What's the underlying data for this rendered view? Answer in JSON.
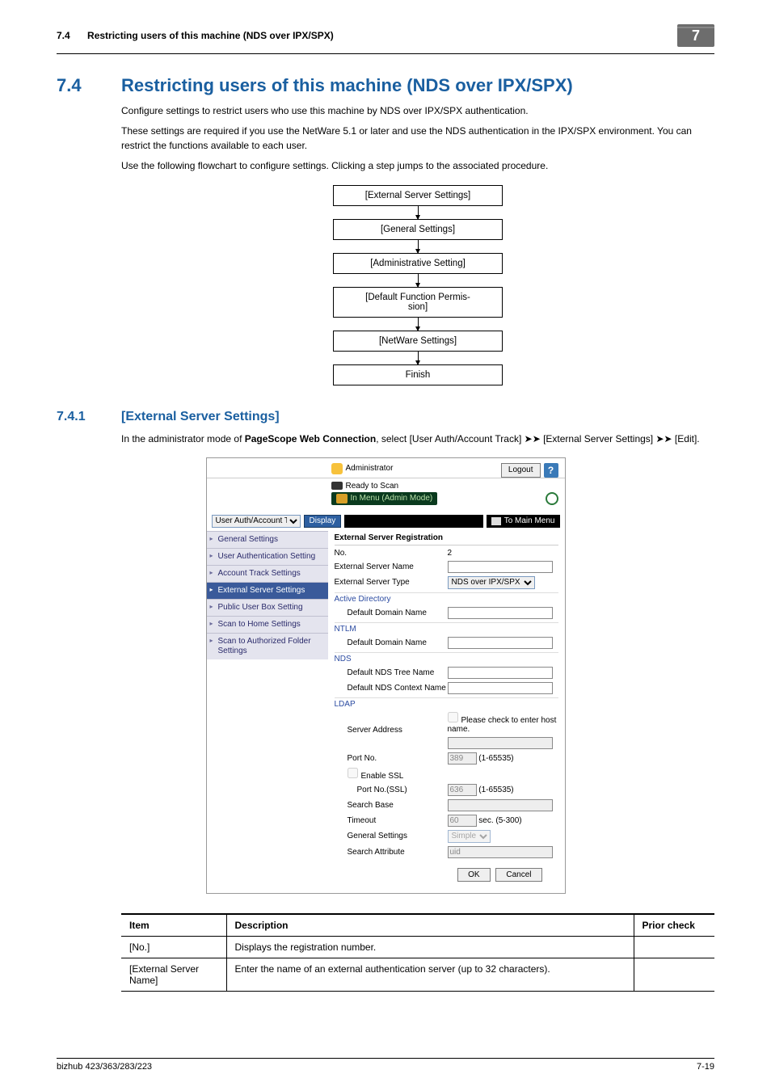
{
  "header": {
    "section_number": "7.4",
    "section_title_short": "Restricting users of this machine (NDS over IPX/SPX)",
    "chapter": "7"
  },
  "h1": {
    "number": "7.4",
    "title": "Restricting users of this machine (NDS over IPX/SPX)"
  },
  "intro": {
    "p1": "Configure settings to restrict users who use this machine by NDS over IPX/SPX authentication.",
    "p2": "These settings are required if you use the NetWare 5.1 or later and use the NDS authentication in the IPX/SPX environment. You can restrict the functions available to each user.",
    "p3": "Use the following flowchart to configure settings. Clicking a step jumps to the associated procedure."
  },
  "flow": {
    "b1": "[External Server Settings]",
    "b2": "[General Settings]",
    "b3": "[Administrative Setting]",
    "b4a": "[Default Function Permis-",
    "b4b": "sion]",
    "b5": "[NetWare Settings]",
    "b6": "Finish"
  },
  "h2": {
    "number": "7.4.1",
    "title": "[External Server Settings]"
  },
  "h2_body": {
    "pre": "In the administrator mode of ",
    "strong": "PageScope Web Connection",
    "mid": ", select [User Auth/Account Track] ",
    "arrow1": "➤➤",
    "post1": " [External Server Settings] ",
    "arrow2": "➤➤",
    "post2": " [Edit]."
  },
  "ss": {
    "admin_label": "Administrator",
    "logout": "Logout",
    "help": "?",
    "ready": "Ready to Scan",
    "in_menu": "In Menu (Admin Mode)",
    "tab_select": "User Auth/Account Track",
    "display_btn": "Display",
    "to_main": "To Main Menu",
    "nav": {
      "n1": "General Settings",
      "n2": "User Authentication Setting",
      "n3": "Account Track Settings",
      "n4": "External Server Settings",
      "n5": "Public User Box Setting",
      "n6": "Scan to Home Settings",
      "n7": "Scan to Authorized Folder Settings"
    },
    "form": {
      "title": "External Server Registration",
      "no_label": "No.",
      "no_value": "2",
      "esn_label": "External Server Name",
      "est_label": "External Server Type",
      "est_value": "NDS over IPX/SPX",
      "ad": "Active Directory",
      "ad_ddn": "Default Domain Name",
      "ntlm": "NTLM",
      "ntlm_ddn": "Default Domain Name",
      "nds": "NDS",
      "nds_tree": "Default NDS Tree Name",
      "nds_ctx": "Default NDS Context Name",
      "ldap": "LDAP",
      "ldap_sa": "Server Address",
      "ldap_sa_chk": "Please check to enter host name.",
      "ldap_port": "Port No.",
      "ldap_port_v": "389",
      "ldap_port_hint": "(1-65535)",
      "ldap_ssl": "Enable SSL",
      "ldap_sslport": "Port No.(SSL)",
      "ldap_sslport_v": "636",
      "ldap_sslport_hint": "(1-65535)",
      "ldap_sb": "Search Base",
      "ldap_to": "Timeout",
      "ldap_to_v": "60",
      "ldap_to_hint": "sec. (5-300)",
      "ldap_gs": "General Settings",
      "ldap_gs_v": "Simple",
      "ldap_sattr": "Search Attribute",
      "ldap_sattr_v": "uid",
      "ok": "OK",
      "cancel": "Cancel"
    }
  },
  "table": {
    "h_item": "Item",
    "h_desc": "Description",
    "h_prior": "Prior check",
    "r1_item": "[No.]",
    "r1_desc": "Displays the registration number.",
    "r1_prior": "",
    "r2_item": "[External Server Name]",
    "r2_desc": "Enter the name of an external authentication server (up to 32 characters).",
    "r2_prior": ""
  },
  "footer": {
    "model": "bizhub 423/363/283/223",
    "page": "7-19"
  }
}
